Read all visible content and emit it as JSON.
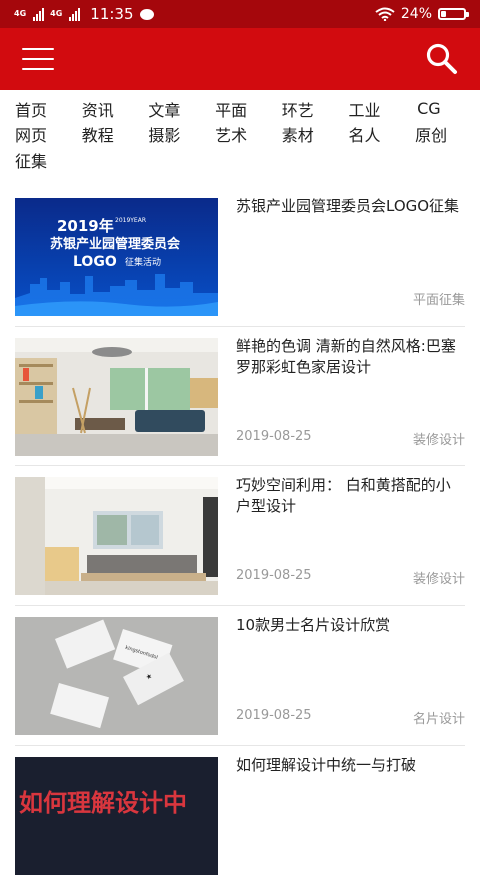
{
  "status": {
    "network_left": "4G",
    "network_right": "4G",
    "time": "11:35",
    "battery_text": "24%",
    "battery_level": 0.24
  },
  "nav": [
    [
      "首页",
      "资讯",
      "文章",
      "平面",
      "环艺",
      "工业",
      "CG"
    ],
    [
      "网页",
      "教程",
      "摄影",
      "艺术",
      "素材",
      "名人",
      "原创"
    ],
    [
      "征集"
    ]
  ],
  "articles": [
    {
      "title": "苏银产业园管理委员会LOGO征集",
      "date": "",
      "tag": "平面征集",
      "thumb": {
        "line1": "2019年",
        "line1_small": "2019YEAR",
        "line2": "苏银产业园管理委员会",
        "line3": "LOGO",
        "line3b": "征集活动"
      }
    },
    {
      "title": "鲜艳的色调 清新的自然风格:巴塞罗那彩虹色家居设计",
      "date": "2019-08-25",
      "tag": "装修设计"
    },
    {
      "title": "巧妙空间利用： 白和黄搭配的小户型设计",
      "date": "2019-08-25",
      "tag": "装修设计"
    },
    {
      "title": "10款男士名片设计欣赏",
      "date": "2019-08-25",
      "tag": "名片设计",
      "thumb": {
        "card_text": "kingstonfodol."
      }
    },
    {
      "title": "如何理解设计中统一与打破",
      "date": "",
      "tag": "",
      "thumb": {
        "text": "如何理解设计中"
      }
    }
  ],
  "colors": {
    "statusbar": "#a5070c",
    "topbar": "#d20b0f",
    "meta_text": "#999999"
  },
  "icons": {
    "menu": "hamburger-menu-icon",
    "search": "search-icon"
  }
}
